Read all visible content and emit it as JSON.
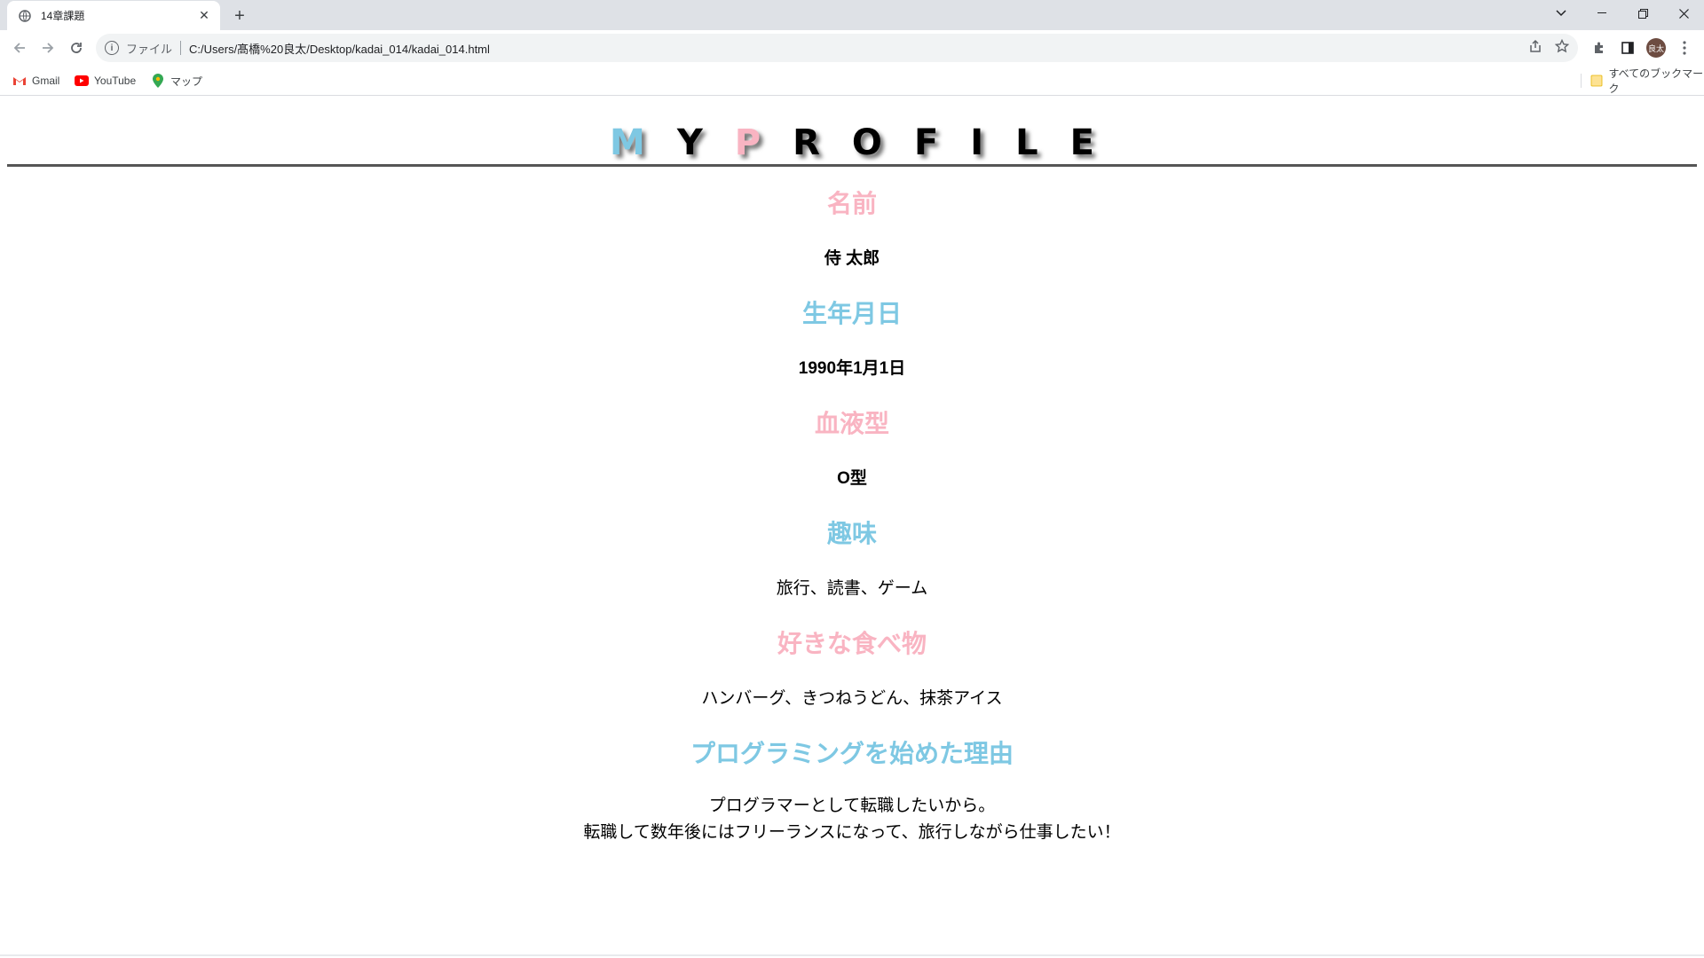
{
  "browser": {
    "tab_title": "14章課題",
    "tab_close": "✕",
    "new_tab": "+",
    "omnibox_file_label": "ファイル",
    "url": "C:/Users/髙橋%20良太/Desktop/kadai_014/kadai_014.html",
    "avatar_text": "良太",
    "bookmarks": [
      {
        "label": "Gmail",
        "icon": "gmail-icon"
      },
      {
        "label": "YouTube",
        "icon": "youtube-icon"
      },
      {
        "label": "マップ",
        "icon": "maps-icon"
      }
    ],
    "all_bookmarks": "すべてのブックマーク",
    "colors": {
      "tabbar": "#dee1e6",
      "omnibox": "#f1f3f4"
    }
  },
  "page": {
    "logo_letters": [
      {
        "char": "M",
        "color": "blue"
      },
      {
        "char": "Y",
        "color": "black"
      },
      {
        "char": "P",
        "color": "pink"
      },
      {
        "char": "R",
        "color": "black"
      },
      {
        "char": "O",
        "color": "black"
      },
      {
        "char": "F",
        "color": "black"
      },
      {
        "char": "I",
        "color": "black"
      },
      {
        "char": "L",
        "color": "black"
      },
      {
        "char": "E",
        "color": "black"
      }
    ],
    "sections": [
      {
        "title": "名前",
        "title_color": "pink",
        "body": [
          "侍 太郎"
        ],
        "bold": true
      },
      {
        "title": "生年月日",
        "title_color": "blue",
        "body": [
          "1990年1月1日"
        ],
        "bold": true
      },
      {
        "title": "血液型",
        "title_color": "pink",
        "body": [
          "O型"
        ],
        "bold": true
      },
      {
        "title": "趣味",
        "title_color": "blue",
        "body": [
          "旅行、読書、ゲーム"
        ],
        "bold": false
      },
      {
        "title": "好きな食べ物",
        "title_color": "pink",
        "body": [
          "ハンバーグ、きつねうどん、抹茶アイス"
        ],
        "bold": false
      },
      {
        "title": "プログラミングを始めた理由",
        "title_color": "blue",
        "body": [
          "プログラマーとして転職したいから。",
          "転職して数年後にはフリーランスになって、旅行しながら仕事したい！"
        ],
        "bold": false
      }
    ],
    "colors": {
      "pink": "#f9b4c2",
      "blue": "#7ec8e3",
      "rule": "#555555"
    }
  }
}
